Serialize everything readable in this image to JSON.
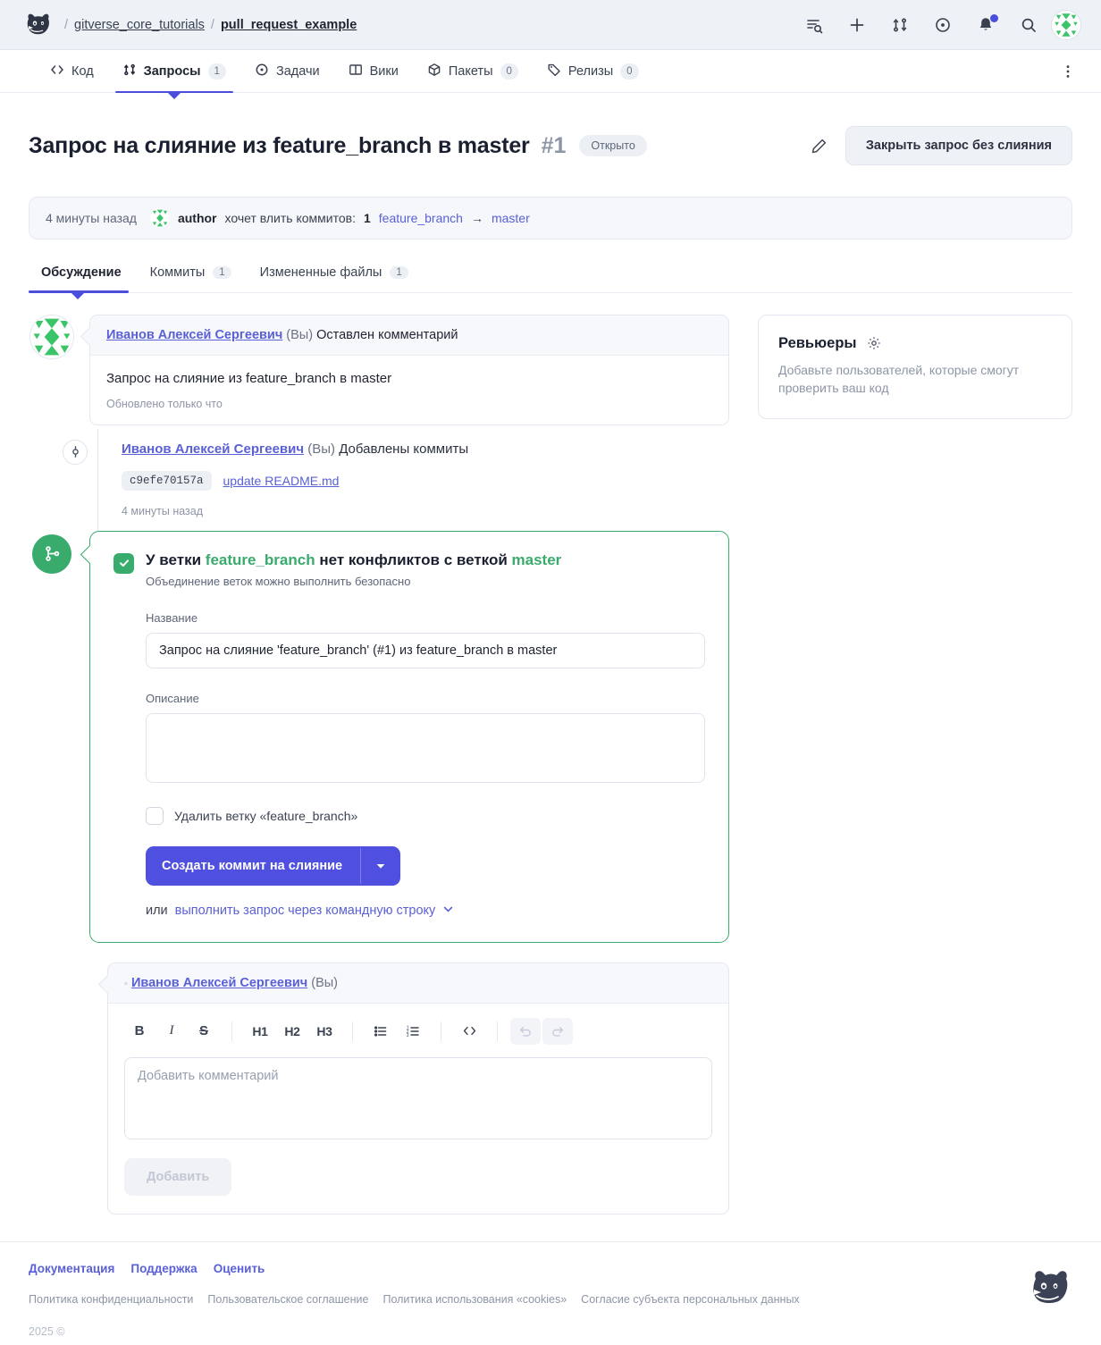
{
  "header": {
    "breadcrumb": {
      "separator": "/",
      "org": "gitverse_core_tutorials",
      "repo": "pull_request_example"
    },
    "icons": [
      {
        "name": "list-search-icon",
        "label": "Поиск по спискам"
      },
      {
        "name": "plus-icon",
        "label": "Создать"
      },
      {
        "name": "pull-request-icon",
        "label": "Запросы на слияние"
      },
      {
        "name": "issue-circle-icon",
        "label": "Задачи"
      },
      {
        "name": "bell-icon",
        "label": "Уведомления",
        "has_dot": true
      },
      {
        "name": "search-icon",
        "label": "Поиск"
      }
    ],
    "avatar_name": "user-avatar"
  },
  "repo_nav": {
    "tabs": [
      {
        "label": "Код",
        "icon": "code-icon",
        "count": null,
        "active": false
      },
      {
        "label": "Запросы",
        "icon": "pull-request-icon",
        "count": "1",
        "active": true
      },
      {
        "label": "Задачи",
        "icon": "issue-circle-icon",
        "count": null,
        "active": false
      },
      {
        "label": "Вики",
        "icon": "book-icon",
        "count": null,
        "active": false
      },
      {
        "label": "Пакеты",
        "icon": "package-icon",
        "count": "0",
        "active": false
      },
      {
        "label": "Релизы",
        "icon": "tag-icon",
        "count": "0",
        "active": false
      }
    ],
    "kebab_label": "Ещё"
  },
  "pr": {
    "title": "Запрос на слияние из feature_branch в master",
    "number": "#1",
    "state": "Открыто",
    "edit_label": "Редактировать",
    "close_button": "Закрыть запрос без слияния"
  },
  "summary": {
    "time_ago": "4 минуты назад",
    "author": "author",
    "text": "хочет влить коммитов:",
    "commits_count": "1",
    "source_branch": "feature_branch",
    "arrow": "→",
    "target_branch": "master"
  },
  "sub_tabs": [
    {
      "label": "Обсуждение",
      "count": null,
      "active": true
    },
    {
      "label": "Коммиты",
      "count": "1",
      "active": false
    },
    {
      "label": "Измененные файлы",
      "count": "1",
      "active": false
    }
  ],
  "timeline": {
    "comment": {
      "author": "Иванов Алексей Сергеевич",
      "you": "(Вы)",
      "action": "Оставлен комментарий",
      "body": "Запрос на слияние из feature_branch в master",
      "updated": "Обновлено только что"
    },
    "commits_event": {
      "author": "Иванов Алексей Сергеевич",
      "you": "(Вы)",
      "action": "Добавлены коммиты",
      "sha": "c9efe70157a",
      "message": "update README.md",
      "time_ago": "4 минуты назад"
    }
  },
  "merge": {
    "heading_prefix": "У ветки",
    "source_branch": "feature_branch",
    "heading_middle": "нет конфликтов с веткой",
    "target_branch": "master",
    "subtitle": "Объединение веток можно выполнить безопасно",
    "title_label": "Название",
    "title_value": "Запрос на слияние 'feature_branch' (#1) из feature_branch в master",
    "desc_label": "Описание",
    "desc_value": "",
    "desc_placeholder": "",
    "delete_branch_label": "Удалить ветку «feature_branch»",
    "delete_branch_checked": false,
    "merge_button": "Создать коммит на слияние",
    "dropdown_icon": "chevron-down-icon",
    "cli_or": "или",
    "cli_link": "выполнить запрос через командную строку"
  },
  "new_comment": {
    "author": "Иванов Алексей Сергеевич",
    "you": "(Вы)",
    "toolbar": [
      {
        "name": "bold-icon",
        "glyph": "B"
      },
      {
        "name": "italic-icon",
        "glyph": "I"
      },
      {
        "name": "strikethrough-icon",
        "glyph": "S"
      },
      {
        "name": "heading-1-icon",
        "glyph": "H1"
      },
      {
        "name": "heading-2-icon",
        "glyph": "H2"
      },
      {
        "name": "heading-3-icon",
        "glyph": "H3"
      },
      {
        "name": "bullet-list-icon",
        "glyph": "list"
      },
      {
        "name": "numbered-list-icon",
        "glyph": "olist"
      },
      {
        "name": "code-icon",
        "glyph": "</>"
      },
      {
        "name": "undo-icon",
        "glyph": "undo",
        "disabled": true
      },
      {
        "name": "redo-icon",
        "glyph": "redo",
        "disabled": true
      }
    ],
    "placeholder": "Добавить комментарий",
    "value": "",
    "submit_label": "Добавить"
  },
  "sidebar": {
    "reviewers": {
      "title": "Ревьюеры",
      "gear_icon": "gear-icon",
      "description": "Добавьте пользователей, которые смогут проверить ваш код"
    }
  },
  "footer": {
    "primary_links": [
      "Документация",
      "Поддержка",
      "Оценить"
    ],
    "secondary_links": [
      "Политика конфиденциальности",
      "Пользовательское соглашение",
      "Политика использования «cookies»",
      "Согласие субъекта персональных данных"
    ],
    "copyright": "2025 ©",
    "logo_name": "gitverse-dog-logo"
  },
  "colors": {
    "accent": "#4b4ddb",
    "link": "#5a60d6",
    "success": "#39ab6c",
    "button_primary": "#4f4fe0",
    "header_bg": "#eef1f6"
  }
}
